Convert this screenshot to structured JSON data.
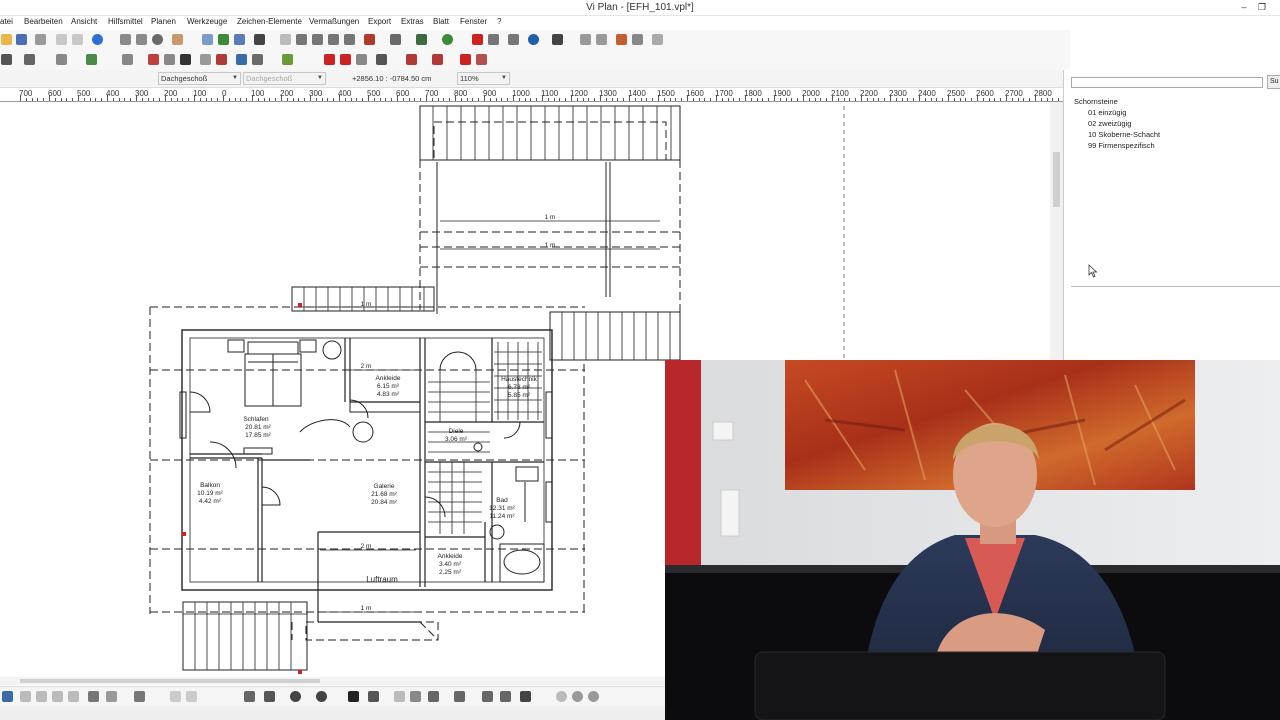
{
  "window": {
    "title": "Vi Plan - [EFH_101.vpl*]",
    "controls": [
      "–",
      "❐"
    ]
  },
  "menu": {
    "items": [
      "atei",
      "Bearbeiten",
      "Ansicht",
      "Hilfsmittel",
      "Planen",
      "Werkzeuge",
      "Zeichen-Elemente",
      "Vermaßungen",
      "Export",
      "Extras",
      "Blatt",
      "Fenster",
      "?"
    ]
  },
  "statusbar": {
    "floor_select": "Dachgeschoß",
    "floor_select2": "Dachgeschoß",
    "coordinates": "+2856.10 : -0784.50 cm",
    "zoom": "110%"
  },
  "ruler": {
    "labels": [
      "700",
      "600",
      "500",
      "400",
      "300",
      "200",
      "100",
      "0",
      "100",
      "200",
      "300",
      "400",
      "500",
      "600",
      "700",
      "800",
      "900",
      "1000",
      "1100",
      "1200",
      "1300",
      "1400",
      "1500",
      "1600",
      "1700",
      "1800",
      "1900",
      "2000",
      "2100",
      "2200",
      "2300",
      "2400",
      "2500",
      "2600",
      "2700",
      "2800"
    ]
  },
  "plan": {
    "rooms": [
      {
        "name": "Schlafen",
        "area1": "20.81 m²",
        "area2": "17.85 m²"
      },
      {
        "name": "Ankleide",
        "area1": "6.15 m²",
        "area2": "4.83 m²"
      },
      {
        "name": "Haustechnik",
        "area1": "6.78 m²",
        "area2": "5.85 m²"
      },
      {
        "name": "Diele",
        "area1": "3.06 m²",
        "area2": ""
      },
      {
        "name": "Balkon",
        "area1": "10.19 m²",
        "area2": "4.42 m²"
      },
      {
        "name": "Galerie",
        "area1": "21.68 m²",
        "area2": "20.84 m²"
      },
      {
        "name": "Bad",
        "area1": "12.31 m²",
        "area2": "11.24 m²"
      },
      {
        "name": "Ankleide",
        "area1": "3.40 m²",
        "area2": "2.25 m²"
      },
      {
        "name": "Luftraum",
        "area1": "",
        "area2": ""
      }
    ],
    "dims": {
      "d_1m_a": "1 m",
      "d_1m_b": "1 m",
      "d_1m_c": "1 m",
      "d_1m_d": "1 m",
      "d_2m_a": "2 m",
      "d_2m_b": "2 m"
    }
  },
  "right_panel": {
    "search_button": "Su",
    "tree_root": "Schornsteine",
    "tree_children": [
      "01 einzügig",
      "02 zweizügig",
      "10 Skoberne-Schacht",
      "99 Firmenspezifisch"
    ]
  },
  "colors": {
    "plan_line": "#222222",
    "webcam_wall": "#e4e5e7",
    "painting_red": "#b8361c",
    "accent_red": "#cc2222"
  }
}
